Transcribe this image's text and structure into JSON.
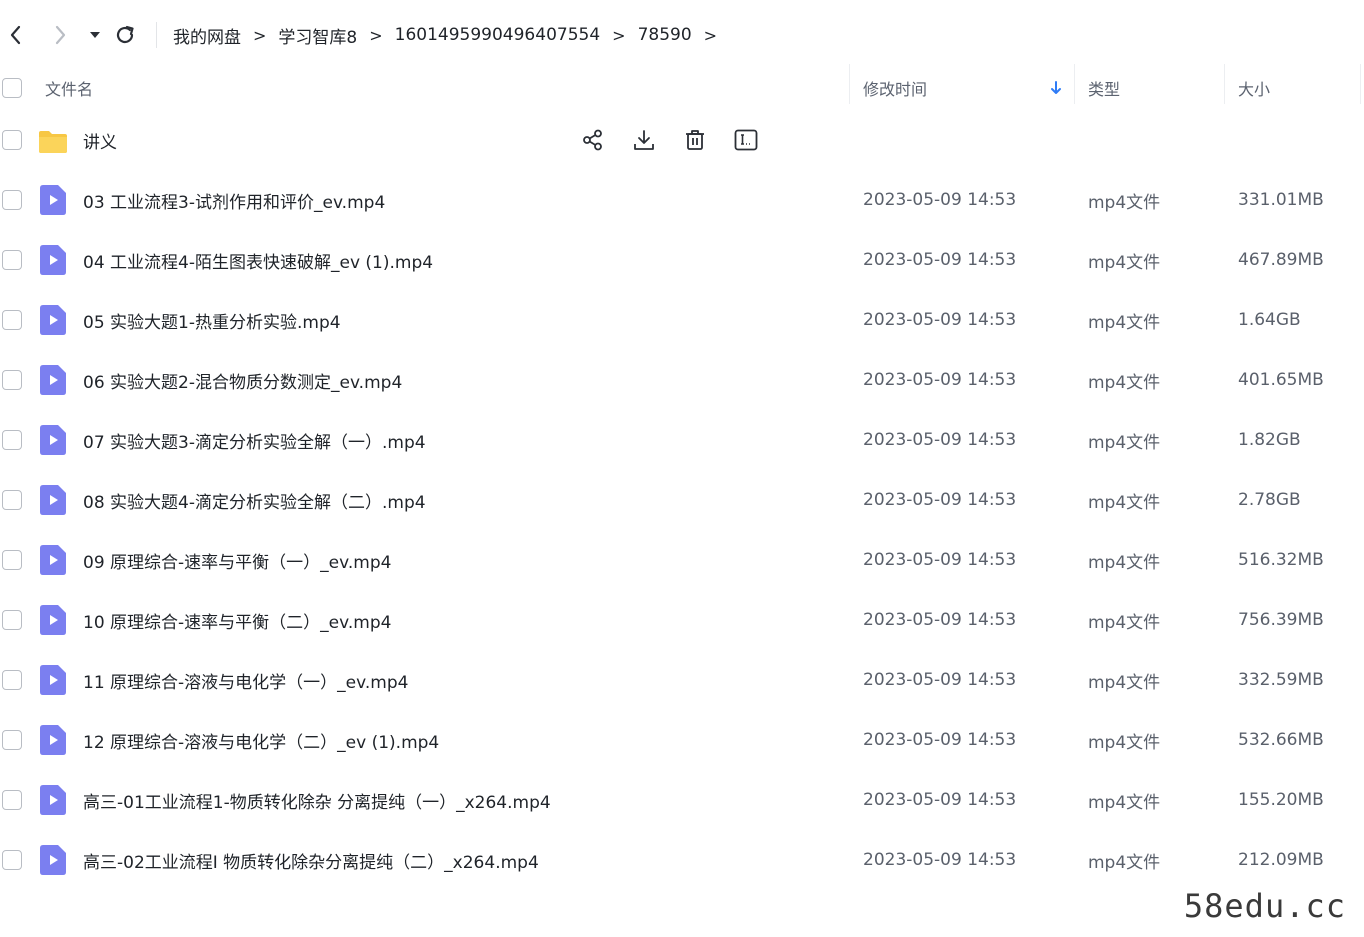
{
  "breadcrumb": [
    "我的网盘",
    "学习智库8",
    "1601495990496407554",
    "78590"
  ],
  "breadcrumb_separator": ">",
  "header": {
    "name": "文件名",
    "modified": "修改时间",
    "type": "类型",
    "size": "大小"
  },
  "folder": {
    "name": "讲义",
    "icon": "folder-icon"
  },
  "files": [
    {
      "name": "03 工业流程3-试剂作用和评价_ev.mp4",
      "date": "2023-05-09 14:53",
      "type": "mp4文件",
      "size": "331.01MB"
    },
    {
      "name": "04 工业流程4-陌生图表快速破解_ev (1).mp4",
      "date": "2023-05-09 14:53",
      "type": "mp4文件",
      "size": "467.89MB"
    },
    {
      "name": "05 实验大题1-热重分析实验.mp4",
      "date": "2023-05-09 14:53",
      "type": "mp4文件",
      "size": "1.64GB"
    },
    {
      "name": "06 实验大题2-混合物质分数测定_ev.mp4",
      "date": "2023-05-09 14:53",
      "type": "mp4文件",
      "size": "401.65MB"
    },
    {
      "name": "07 实验大题3-滴定分析实验全解（一）.mp4",
      "date": "2023-05-09 14:53",
      "type": "mp4文件",
      "size": "1.82GB"
    },
    {
      "name": "08 实验大题4-滴定分析实验全解（二）.mp4",
      "date": "2023-05-09 14:53",
      "type": "mp4文件",
      "size": "2.78GB"
    },
    {
      "name": "09 原理综合-速率与平衡（一）_ev.mp4",
      "date": "2023-05-09 14:53",
      "type": "mp4文件",
      "size": "516.32MB"
    },
    {
      "name": "10 原理综合-速率与平衡（二）_ev.mp4",
      "date": "2023-05-09 14:53",
      "type": "mp4文件",
      "size": "756.39MB"
    },
    {
      "name": "11 原理综合-溶液与电化学（一）_ev.mp4",
      "date": "2023-05-09 14:53",
      "type": "mp4文件",
      "size": "332.59MB"
    },
    {
      "name": "12 原理综合-溶液与电化学（二）_ev (1).mp4",
      "date": "2023-05-09 14:53",
      "type": "mp4文件",
      "size": "532.66MB"
    },
    {
      "name": "高三-01工业流程1-物质转化除杂 分离提纯（一）_x264.mp4",
      "date": "2023-05-09 14:53",
      "type": "mp4文件",
      "size": "155.20MB"
    },
    {
      "name": "高三-02工业流程I 物质转化除杂分离提纯（二）_x264.mp4",
      "date": "2023-05-09 14:53",
      "type": "mp4文件",
      "size": "212.09MB"
    }
  ],
  "watermark": "58edu.cc",
  "colors": {
    "folder": "#f7c744",
    "video_icon": "#7b7ff0",
    "sort_arrow": "#2f7cf6"
  }
}
